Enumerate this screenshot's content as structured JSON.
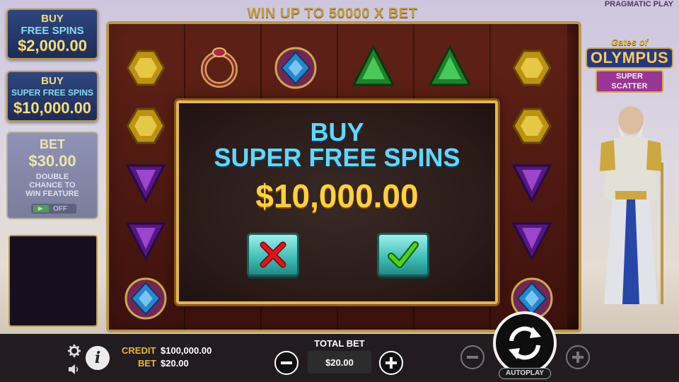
{
  "header": {
    "win_up": "WIN UP TO 50000 X BET",
    "brand": "PRAGMATIC PLAY"
  },
  "side": {
    "buy_free_spins": {
      "line1": "BUY",
      "line2": "FREE SPINS",
      "price": "$2,000.00"
    },
    "buy_super_free_spins": {
      "line1": "BUY",
      "line2": "SUPER FREE SPINS",
      "price": "$10,000.00"
    },
    "bet_panel": {
      "title": "BET",
      "amount": "$30.00",
      "desc1": "DOUBLE",
      "desc2": "CHANCE TO",
      "desc3": "WIN FEATURE",
      "toggle": "OFF"
    }
  },
  "logo": {
    "line1": "Gates of",
    "line2": "OLYMPUS",
    "line3": "SUPER SCATTER"
  },
  "modal": {
    "title_line1": "BUY",
    "title_line2": "SUPER FREE SPINS",
    "price": "$10,000.00",
    "cancel_icon": "x-icon",
    "confirm_icon": "check-icon"
  },
  "bottom": {
    "credit_label": "CREDIT",
    "credit_value": "$100,000.00",
    "bet_label": "BET",
    "bet_value": "$20.00",
    "total_bet_label": "TOTAL BET",
    "total_bet_value": "$20.00",
    "autoplay_label": "AUTOPLAY"
  },
  "colors": {
    "gold": "#e3b84c",
    "cyan_title": "#5fd8ff",
    "price_yellow": "#ffd23a",
    "cancel_red": "#e0141e",
    "confirm_green": "#4fd414"
  }
}
